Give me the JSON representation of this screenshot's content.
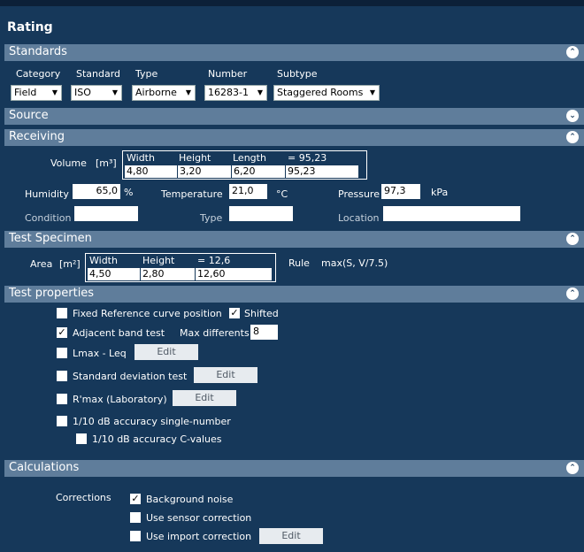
{
  "title": "Rating",
  "standards": {
    "header": "Standards",
    "category_label": "Category",
    "standard_label": "Standard",
    "type_label": "Type",
    "number_label": "Number",
    "subtype_label": "Subtype",
    "category_value": "Field",
    "standard_value": "ISO",
    "type_value": "Airborne",
    "number_value": "16283-1",
    "subtype_value": "Staggered Rooms"
  },
  "source": {
    "header": "Source"
  },
  "receiving": {
    "header": "Receiving",
    "volume_label": "Volume",
    "volume_unit": "[m³]",
    "width_label": "Width",
    "height_label": "Height",
    "length_label": "Length",
    "eq_label": "= 95,23",
    "width_value": "4,80",
    "height_value": "3,20",
    "length_value": "6,20",
    "volume_value": "95,23",
    "humidity_label": "Humidity",
    "humidity_value": "65,0",
    "humidity_unit": "%",
    "temperature_label": "Temperature",
    "temperature_value": "21,0",
    "temperature_unit": "°C",
    "pressure_label": "Pressure",
    "pressure_value": "97,3",
    "pressure_unit": "kPa",
    "condition_label": "Condition",
    "type_label": "Type",
    "location_label": "Location"
  },
  "specimen": {
    "header": "Test Specimen",
    "area_label": "Area",
    "area_unit": "[m²]",
    "width_label": "Width",
    "height_label": "Height",
    "eq_label": "= 12,6",
    "width_value": "4,50",
    "height_value": "2,80",
    "area_value": "12,60",
    "rule_label": "Rule",
    "rule_value": "max(S, V/7.5)"
  },
  "test_properties": {
    "header": "Test properties",
    "fixed_ref": "Fixed Reference curve position",
    "shifted": "Shifted",
    "adjacent": "Adjacent band test",
    "max_diff": "Max differents",
    "max_diff_value": "8",
    "lmax": "Lmax - Leq",
    "std_dev": "Standard deviation test",
    "rmax": "R'max (Laboratory)",
    "acc_single": "1/10 dB accuracy single-number",
    "acc_c": "1/10 dB accuracy C-values",
    "edit": "Edit",
    "check": "✓"
  },
  "calculations": {
    "header": "Calculations",
    "corrections_label": "Corrections",
    "background": "Background noise",
    "sensor": "Use sensor correction",
    "import": "Use import correction",
    "edit": "Edit"
  },
  "icons": {
    "collapse": "⌃",
    "expand": "⌄",
    "dropdown": "▼"
  }
}
